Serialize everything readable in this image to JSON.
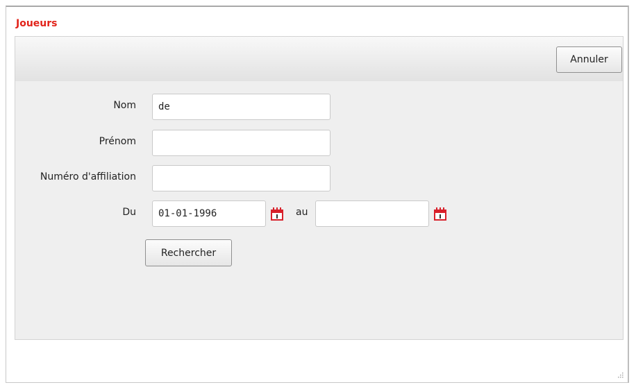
{
  "dialog": {
    "title": "Joueurs",
    "cancel_label": "Annuler"
  },
  "form": {
    "nom_label": "Nom",
    "nom_value": "de",
    "prenom_label": "Prénom",
    "prenom_value": "",
    "affiliation_label": "Numéro d'affiliation",
    "affiliation_value": "",
    "du_label": "Du",
    "du_value": "01-01-1996",
    "au_label": "au",
    "au_value": "",
    "search_label": "Rechercher"
  },
  "colors": {
    "title": "#e2231a",
    "calendar_icon": "#d8202a"
  },
  "icons": {
    "date_picker": "calendar-icon",
    "resize": "resize-grip-icon"
  }
}
